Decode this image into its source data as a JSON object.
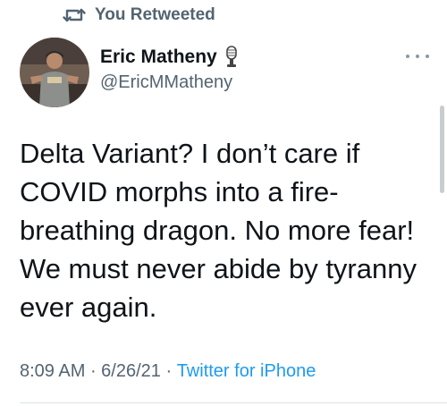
{
  "retweet": {
    "label": "You Retweeted",
    "icon": "retweet-icon"
  },
  "author": {
    "name": "Eric Matheny",
    "handle": "@EricMMatheny",
    "badge_icon": "microphone-icon",
    "avatar_icon": "avatar-photo"
  },
  "tweet": {
    "text": "Delta Variant? I don’t care if\nCOVID morphs into a fire-\nbreathing dragon. No more fear!\nWe must never abide by tyranny\never again."
  },
  "meta": {
    "time": "8:09 AM",
    "sep1": " · ",
    "date": "6/26/21",
    "sep2": " · ",
    "source": "Twitter for iPhone"
  },
  "colors": {
    "secondary_text": "#536471",
    "link": "#1d9bf0",
    "primary_text": "#0f1419"
  }
}
